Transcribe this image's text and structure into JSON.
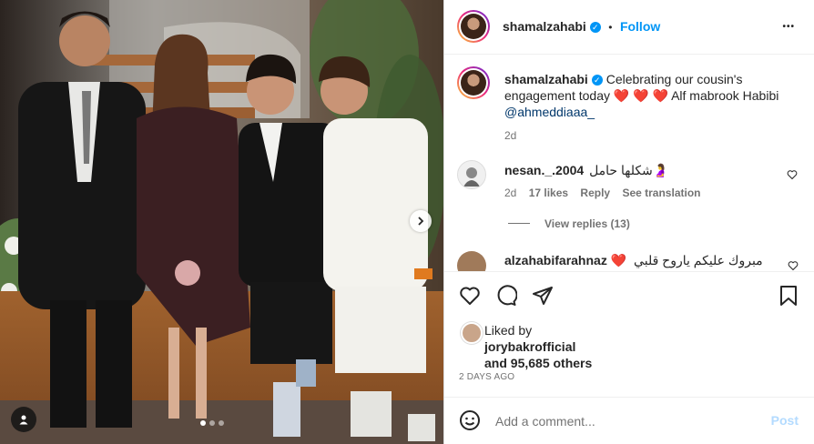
{
  "post": {
    "username": "shamalzahabi",
    "follow_label": "Follow",
    "separator": "•",
    "more_label": "•••",
    "caption_text": "Celebrating our cousin's engagement today",
    "caption_hearts": "❤️ ❤️ ❤️",
    "caption_tail": "Alf mabrook Habibi",
    "caption_mention": "@ahmeddiaaa_",
    "caption_time": "2d"
  },
  "comments": [
    {
      "username": "nesan._.2004",
      "text": "شكلها حامل🤰",
      "time": "2d",
      "likes": "17 likes",
      "reply_label": "Reply",
      "translate_label": "See translation",
      "view_replies": "View replies (13)"
    },
    {
      "username": "alzahabifarahnaz",
      "heart": "❤️",
      "text": "مبروك عليكم ياروح قلبي"
    }
  ],
  "likes": {
    "liked_by_label": "Liked by",
    "liker": "jorybakrofficial",
    "others": "and 95,685 others",
    "date": "2 DAYS AGO"
  },
  "add_comment": {
    "placeholder": "Add a comment...",
    "post_label": "Post"
  },
  "icons": {
    "like": "heart-outline-icon",
    "comment": "comment-bubble-icon",
    "share": "paper-plane-icon",
    "save": "bookmark-icon",
    "emoji": "smiley-icon",
    "next": "chevron-right-icon",
    "tag": "person-tag-icon"
  },
  "colors": {
    "accent": "#0095f6",
    "heart": "#e0143c",
    "mention": "#00376b",
    "muted": "#737373",
    "post_disabled": "#b3dbff"
  }
}
